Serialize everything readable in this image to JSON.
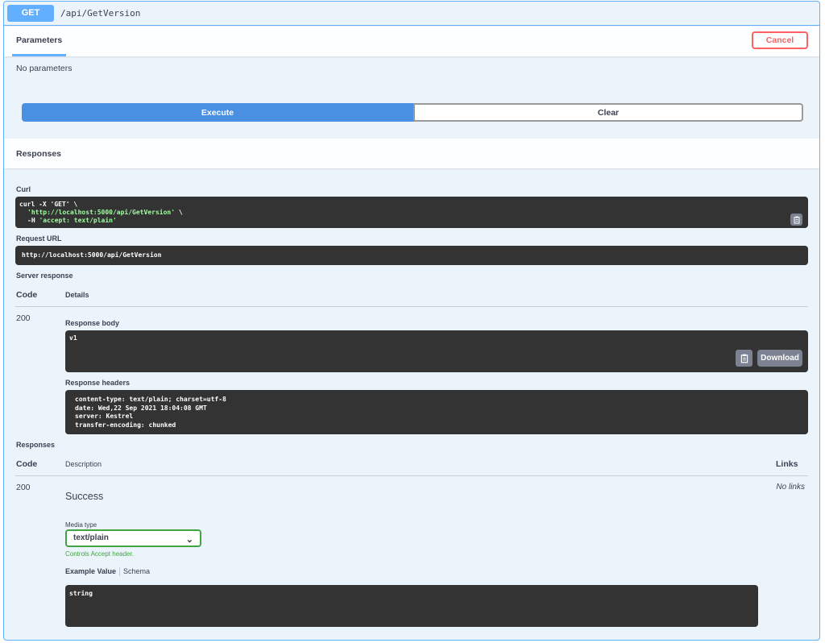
{
  "summary": {
    "method": "GET",
    "path": "/api/GetVersion"
  },
  "params": {
    "tab_label": "Parameters",
    "cancel_label": "Cancel",
    "empty_text": "No parameters"
  },
  "actions": {
    "execute_label": "Execute",
    "clear_label": "Clear"
  },
  "responses_section": {
    "title": "Responses"
  },
  "curl": {
    "label": "Curl",
    "line1": "curl -X 'GET' \\",
    "line2_url": "'http://localhost:5000/api/GetVersion'",
    "line2_suffix": " \\",
    "line3_prefix": "-H ",
    "line3_header": "'accept: text/plain'",
    "copy_icon": "clipboard-icon"
  },
  "request_url": {
    "label": "Request URL",
    "value": "http://localhost:5000/api/GetVersion"
  },
  "server_response": {
    "label": "Server response",
    "col_code": "Code",
    "col_details": "Details",
    "code": "200",
    "body_label": "Response body",
    "body": "v1",
    "download_label": "Download",
    "headers_label": "Response headers",
    "headers": [
      "content-type: text/plain; charset=utf-8",
      "date: Wed,22 Sep 2021 18:04:08 GMT",
      "server: Kestrel",
      "transfer-encoding: chunked"
    ]
  },
  "responses_table": {
    "label": "Responses",
    "col_code": "Code",
    "col_description": "Description",
    "col_links": "Links",
    "code": "200",
    "description": "Success",
    "media_type_label": "Media type",
    "media_type_value": "text/plain",
    "controls_note": "Controls Accept header.",
    "tab_example": "Example Value",
    "tab_schema": "Schema",
    "example": "string",
    "links": "No links"
  },
  "colors": {
    "get_blue": "#61affe",
    "execute_blue": "#4990e2",
    "cancel_red": "#ff6060",
    "valid_green": "#41a441",
    "code_bg": "#333333"
  }
}
